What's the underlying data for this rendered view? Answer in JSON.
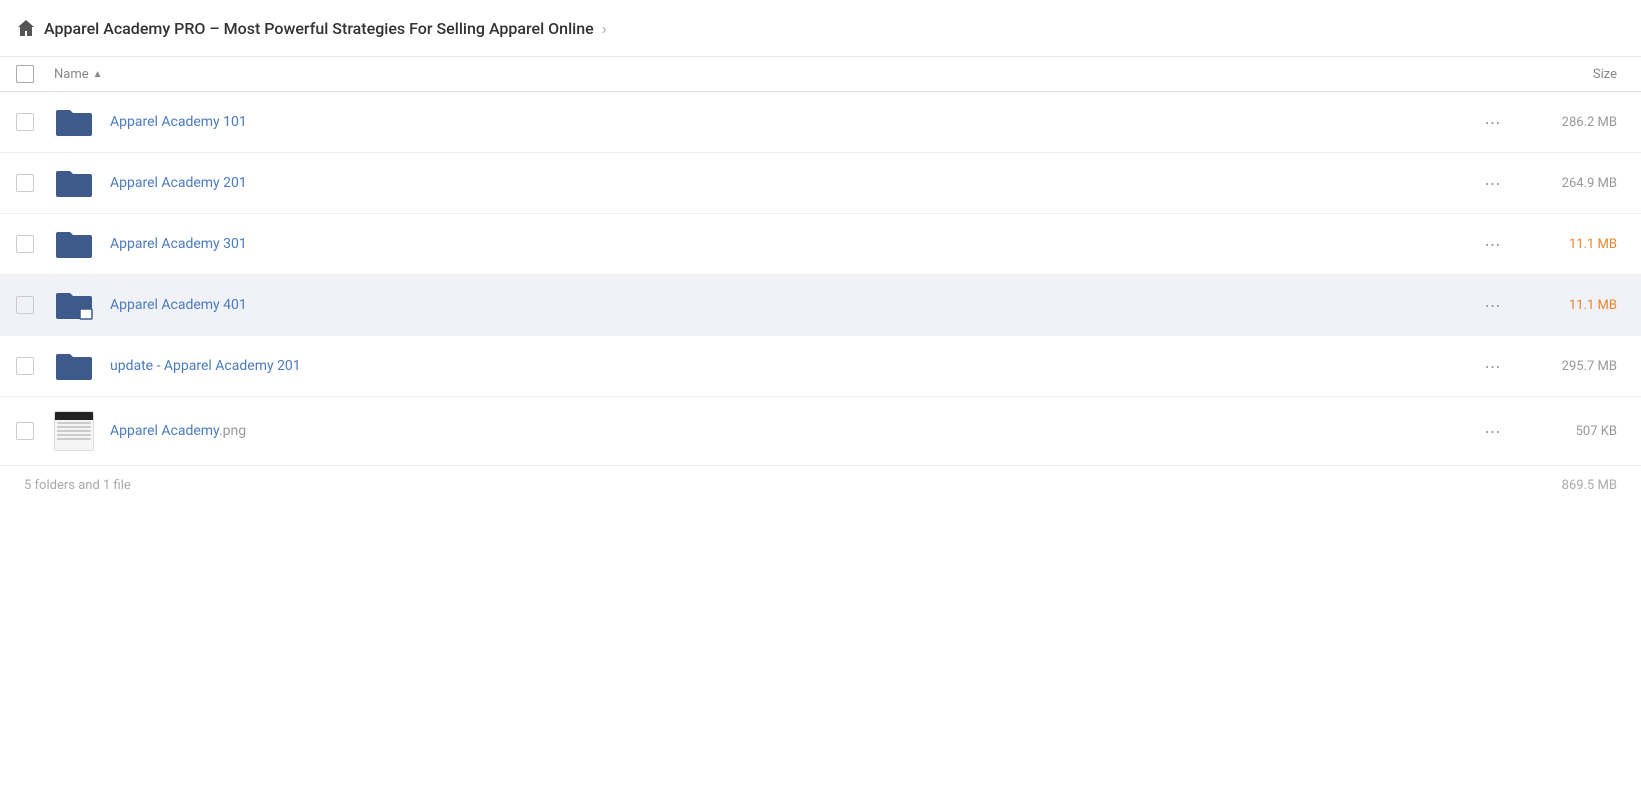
{
  "breadcrumb": {
    "home_icon": "home",
    "title": "Apparel Academy PRO – Most Powerful Strategies For Selling Apparel Online",
    "chevron": "›"
  },
  "table_header": {
    "name_label": "Name",
    "sort_arrow": "▲",
    "size_label": "Size"
  },
  "items": [
    {
      "id": 1,
      "type": "folder",
      "name": "Apparel Academy 101",
      "size": "286.2 MB",
      "size_color": "normal",
      "highlighted": false,
      "badge": false
    },
    {
      "id": 2,
      "type": "folder",
      "name": "Apparel Academy 201",
      "size": "264.9 MB",
      "size_color": "normal",
      "highlighted": false,
      "badge": false
    },
    {
      "id": 3,
      "type": "folder",
      "name": "Apparel Academy 301",
      "size": "11.1 MB",
      "size_color": "orange",
      "highlighted": false,
      "badge": false
    },
    {
      "id": 4,
      "type": "folder",
      "name": "Apparel Academy 401",
      "size": "11.1 MB",
      "size_color": "orange",
      "highlighted": true,
      "badge": true
    },
    {
      "id": 5,
      "type": "folder",
      "name": "update - Apparel Academy 201",
      "size": "295.7 MB",
      "size_color": "normal",
      "highlighted": false,
      "badge": false
    },
    {
      "id": 6,
      "type": "file",
      "name": "Apparel Academy",
      "ext": ".png",
      "size": "507 KB",
      "size_color": "normal",
      "highlighted": false,
      "badge": false
    }
  ],
  "footer": {
    "summary": "5 folders and 1 file",
    "total_size": "869.5 MB"
  }
}
